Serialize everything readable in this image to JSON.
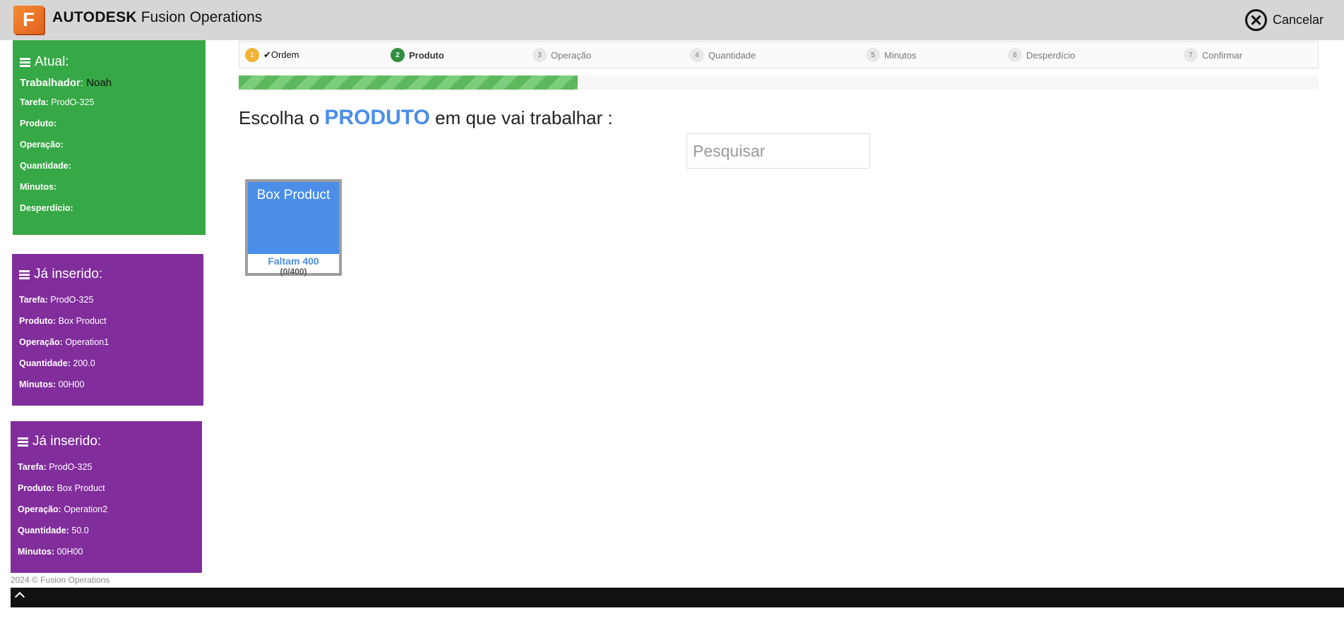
{
  "header": {
    "logo_letter": "F",
    "brand_strong": "AUTODESK",
    "brand_rest": "Fusion Operations",
    "cancel_label": "Cancelar"
  },
  "current": {
    "heading": "Atual:",
    "worker_label": "Trabalhador",
    "worker_value": "Noah",
    "rows": [
      {
        "label": "Tarefa:",
        "value": "ProdO-325"
      },
      {
        "label": "Produto:",
        "value": ""
      },
      {
        "label": "Operação:",
        "value": ""
      },
      {
        "label": "Quantidade:",
        "value": ""
      },
      {
        "label": "Minutos:",
        "value": ""
      },
      {
        "label": "Desperdício:",
        "value": ""
      }
    ]
  },
  "inserted": [
    {
      "heading": "Já inserido:",
      "rows": [
        {
          "label": "Tarefa:",
          "value": "ProdO-325"
        },
        {
          "label": "Produto:",
          "value": "Box Product"
        },
        {
          "label": "Operação:",
          "value": "Operation1"
        },
        {
          "label": "Quantidade:",
          "value": "200.0"
        },
        {
          "label": "Minutos:",
          "value": "00H00"
        }
      ]
    },
    {
      "heading": "Já inserido:",
      "rows": [
        {
          "label": "Tarefa:",
          "value": "ProdO-325"
        },
        {
          "label": "Produto:",
          "value": "Box Product"
        },
        {
          "label": "Operação:",
          "value": "Operation2"
        },
        {
          "label": "Quantidade:",
          "value": "50.0"
        },
        {
          "label": "Minutos:",
          "value": "00H00"
        }
      ]
    }
  ],
  "steps": [
    {
      "n": "1",
      "label": "Ordem",
      "state": "done"
    },
    {
      "n": "2",
      "label": "Produto",
      "state": "active"
    },
    {
      "n": "3",
      "label": "Operação",
      "state": "pending"
    },
    {
      "n": "4",
      "label": "Quantidade",
      "state": "pending"
    },
    {
      "n": "5",
      "label": "Minutos",
      "state": "pending"
    },
    {
      "n": "6",
      "label": "Desperdício",
      "state": "pending"
    },
    {
      "n": "7",
      "label": "Confirmar",
      "state": "pending"
    }
  ],
  "progress": {
    "fraction": 0.314
  },
  "main": {
    "title_before": "Escolha o",
    "title_highlight": "PRODUTO",
    "title_after": "em que vai trabalhar :",
    "search_placeholder": "Pesquisar"
  },
  "products": [
    {
      "name": "Box Product",
      "remaining": "Faltam 400",
      "count": "(0/400)"
    }
  ],
  "footer": {
    "copyright": "2024 © Fusion Operations"
  },
  "colors": {
    "current_panel": "#36a846",
    "inserted_panel": "#812d9c",
    "accent": "#4a8ee8",
    "header": "#d6d6d6"
  }
}
